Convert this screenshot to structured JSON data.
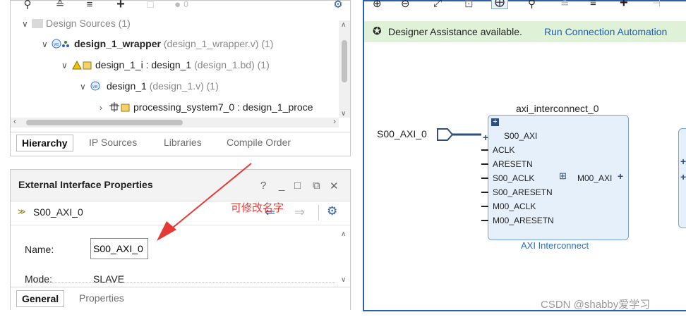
{
  "sources": {
    "toolbar_icons": [
      "search-icon",
      "collapse-all-icon",
      "expand-all-icon",
      "add-icon",
      "unknown-icon",
      "status-dot-icon",
      "gear-icon"
    ],
    "toolbar_count": "0",
    "tree": [
      {
        "name": "Design Sources",
        "suffix": "(1)"
      },
      {
        "name": "design_1_wrapper",
        "suffix": "(design_1_wrapper.v) (1)"
      },
      {
        "name": "design_1_i : design_1",
        "suffix": "(design_1.bd) (1)"
      },
      {
        "name": "design_1",
        "suffix": "(design_1.v) (1)"
      },
      {
        "name": "processing_system7_0 : design_1_proce",
        "suffix": ""
      }
    ],
    "tabs": [
      "Hierarchy",
      "IP Sources",
      "Libraries",
      "Compile Order"
    ]
  },
  "props": {
    "title": "External Interface Properties",
    "header_icons": [
      "help-icon",
      "minimize-icon",
      "maximize-icon",
      "restore-icon",
      "close-icon"
    ],
    "object_name": "S00_AXI_0",
    "fields": [
      {
        "label": "Name:",
        "value": "S00_AXI_0"
      },
      {
        "label": "Mode:",
        "value": "SLAVE"
      }
    ],
    "tabs": [
      "General",
      "Properties"
    ]
  },
  "annotation": {
    "text": "可修改名字",
    "color": "#e53935"
  },
  "canvas": {
    "toolbar_icons": [
      "zoom-in-icon",
      "zoom-out-icon",
      "zoom-fit-icon",
      "fit-selection-icon",
      "auto-fit-icon",
      "search-icon",
      "collapse-icon",
      "expand-icon",
      "add-ip-icon",
      "connect-icon"
    ],
    "banner": {
      "text": "Designer Assistance available.",
      "link": "Run Connection Automation"
    },
    "external_port": "S00_AXI_0",
    "block": {
      "instance": "axi_interconnect_0",
      "type": "AXI Interconnect",
      "left_ports": [
        "S00_AXI",
        "ACLK",
        "ARESETN",
        "S00_ACLK",
        "S00_ARESETN",
        "M00_ACLK",
        "M00_ARESETN"
      ],
      "right_ports": [
        "M00_AXI"
      ]
    }
  },
  "watermark": "CSDN @shabby爱学习",
  "colors": {
    "frame_blue": "#2c5fa8",
    "banner_green": "#dff1d7",
    "link_blue": "#1a5fb4",
    "block_fill": "#e6f0fb",
    "block_border": "#7aa2d6",
    "annotation_red": "#e53935"
  }
}
